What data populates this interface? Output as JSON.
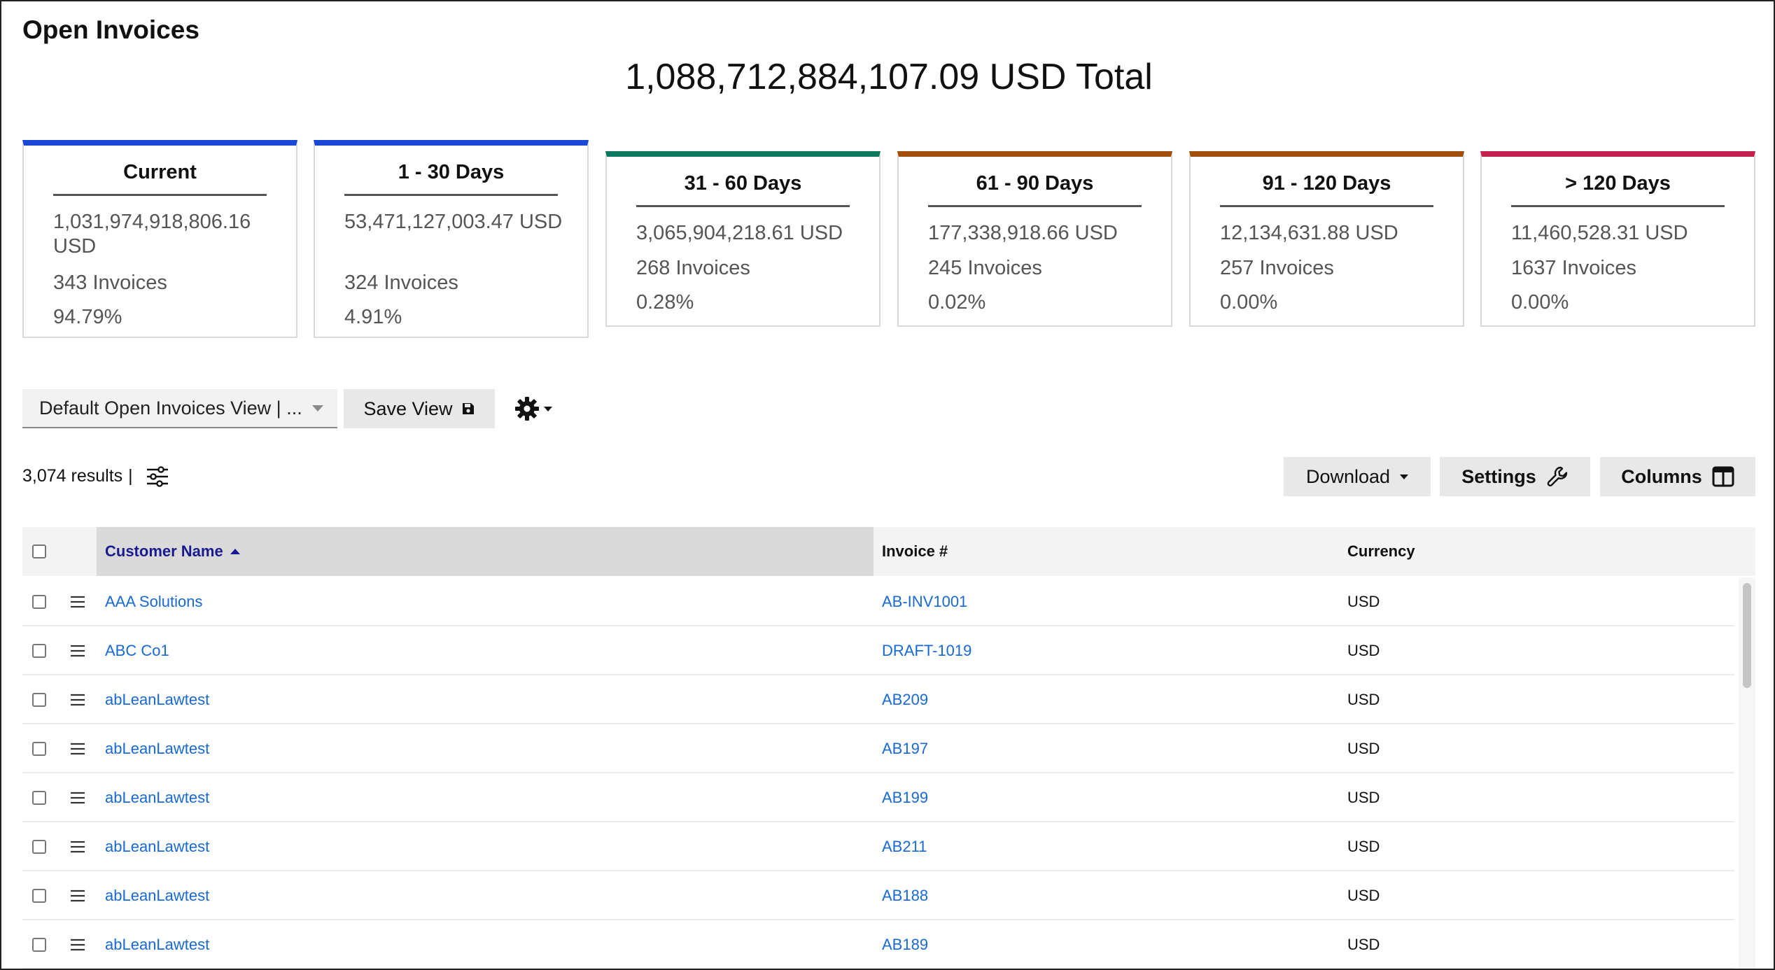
{
  "page": {
    "title": "Open Invoices",
    "grand_total": "1,088,712,884,107.09 USD Total"
  },
  "colors": {
    "blue": "#1c48d6",
    "green": "#0d7a5f",
    "orange": "#a04e0a",
    "crimson": "#c2224d",
    "link": "#1869d6"
  },
  "aging": [
    {
      "title": "Current",
      "amount": "1,031,974,918,806.16 USD",
      "count": "343 Invoices",
      "percent": "94.79%",
      "accent": "blue"
    },
    {
      "title": "1 - 30 Days",
      "amount": "53,471,127,003.47 USD",
      "count": "324 Invoices",
      "percent": "4.91%",
      "accent": "blue"
    },
    {
      "title": "31 - 60 Days",
      "amount": "3,065,904,218.61 USD",
      "count": "268 Invoices",
      "percent": "0.28%",
      "accent": "green"
    },
    {
      "title": "61 - 90 Days",
      "amount": "177,338,918.66 USD",
      "count": "245 Invoices",
      "percent": "0.02%",
      "accent": "orange"
    },
    {
      "title": "91 - 120 Days",
      "amount": "12,134,631.88 USD",
      "count": "257 Invoices",
      "percent": "0.00%",
      "accent": "orange"
    },
    {
      "title": "> 120 Days",
      "amount": "11,460,528.31 USD",
      "count": "1637 Invoices",
      "percent": "0.00%",
      "accent": "crimson"
    }
  ],
  "toolbar": {
    "view_select": "Default Open Invoices View | ...",
    "save_view": "Save View",
    "results": "3,074 results",
    "results_sep": "|",
    "download": "Download",
    "settings": "Settings",
    "columns": "Columns"
  },
  "table": {
    "columns": [
      "Customer Name",
      "Invoice #",
      "Currency"
    ],
    "rows": [
      {
        "customer": "AAA Solutions",
        "invoice": "AB-INV1001",
        "currency": "USD"
      },
      {
        "customer": "ABC Co1",
        "invoice": "DRAFT-1019",
        "currency": "USD"
      },
      {
        "customer": "abLeanLawtest",
        "invoice": "AB209",
        "currency": "USD"
      },
      {
        "customer": "abLeanLawtest",
        "invoice": "AB197",
        "currency": "USD"
      },
      {
        "customer": "abLeanLawtest",
        "invoice": "AB199",
        "currency": "USD"
      },
      {
        "customer": "abLeanLawtest",
        "invoice": "AB211",
        "currency": "USD"
      },
      {
        "customer": "abLeanLawtest",
        "invoice": "AB188",
        "currency": "USD"
      },
      {
        "customer": "abLeanLawtest",
        "invoice": "AB189",
        "currency": "USD"
      }
    ]
  }
}
